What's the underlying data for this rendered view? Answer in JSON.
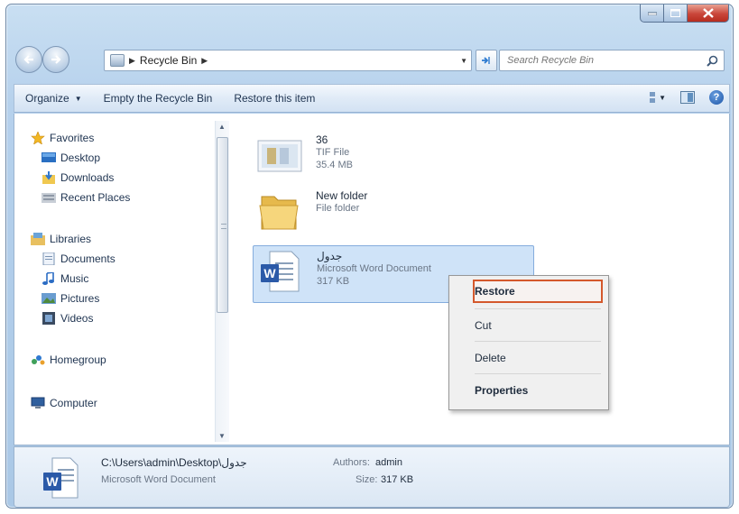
{
  "address": {
    "crumb": "Recycle Bin",
    "search_placeholder": "Search Recycle Bin"
  },
  "toolbar": {
    "organize": "Organize",
    "empty": "Empty the Recycle Bin",
    "restore": "Restore this item"
  },
  "nav": {
    "favorites": "Favorites",
    "desktop": "Desktop",
    "downloads": "Downloads",
    "recent": "Recent Places",
    "libraries": "Libraries",
    "documents": "Documents",
    "music": "Music",
    "pictures": "Pictures",
    "videos": "Videos",
    "homegroup": "Homegroup",
    "computer": "Computer"
  },
  "files": [
    {
      "name": "36",
      "type": "TIF File",
      "size": "35.4 MB"
    },
    {
      "name": "New folder",
      "type": "File folder",
      "size": ""
    },
    {
      "name": "جدول",
      "type": "Microsoft Word Document",
      "size": "317 KB"
    }
  ],
  "context_menu": {
    "restore": "Restore",
    "cut": "Cut",
    "delete": "Delete",
    "properties": "Properties"
  },
  "details": {
    "path": "C:\\Users\\admin\\Desktop\\جدول",
    "type": "Microsoft Word Document",
    "authors_label": "Authors:",
    "authors_value": "admin",
    "size_label": "Size:",
    "size_value": "317 KB"
  },
  "colors": {
    "accent": "#3c7fc4",
    "highlight_border": "#d4582c",
    "selection": "#cfe3f8"
  }
}
